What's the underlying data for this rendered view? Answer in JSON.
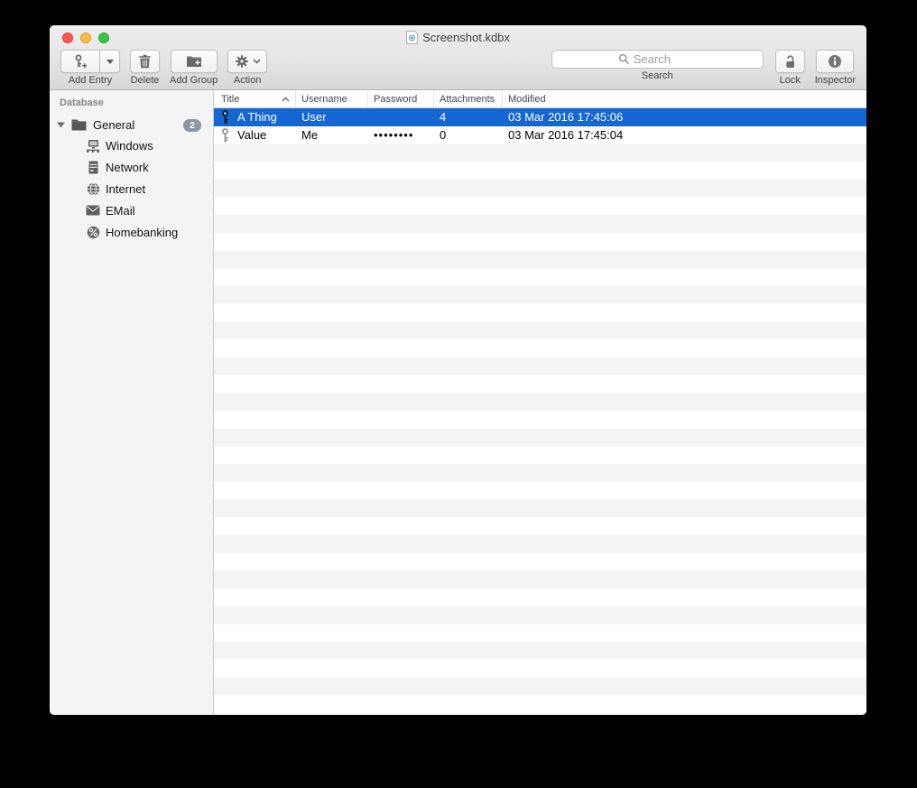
{
  "window": {
    "title": "Screenshot.kdbx",
    "proxy_icon": "kdbx-document-icon"
  },
  "toolbar": {
    "add_entry_label": "Add Entry",
    "delete_label": "Delete",
    "add_group_label": "Add Group",
    "action_label": "Action",
    "search_label": "Search",
    "search_placeholder": "Search",
    "search_value": "",
    "lock_label": "Lock",
    "inspector_label": "Inspector",
    "icons": [
      "key-plus-icon",
      "dropdown-arrow-icon",
      "trash-icon",
      "folder-plus-icon",
      "gear-icon",
      "chevron-down-icon",
      "magnifier-icon",
      "open-padlock-icon",
      "info-circle-icon"
    ]
  },
  "sidebar": {
    "header": "Database",
    "root": {
      "label": "General",
      "badge": "2",
      "icon": "folder-icon",
      "expanded": true
    },
    "items": [
      {
        "label": "Windows",
        "icon": "windows-network-icon"
      },
      {
        "label": "Network",
        "icon": "server-icon"
      },
      {
        "label": "Internet",
        "icon": "globe-icon"
      },
      {
        "label": "EMail",
        "icon": "envelope-icon"
      },
      {
        "label": "Homebanking",
        "icon": "percent-coin-icon"
      }
    ]
  },
  "table": {
    "columns": [
      {
        "label": "Title",
        "sorted": "ascending"
      },
      {
        "label": "Username"
      },
      {
        "label": "Password"
      },
      {
        "label": "Attachments"
      },
      {
        "label": "Modified"
      }
    ],
    "rows": [
      {
        "title": "A Thing",
        "username": "User",
        "password": "",
        "attachments": "4",
        "modified": "03 Mar 2016 17:45:06",
        "selected": true,
        "icon": "key-icon"
      },
      {
        "title": "Value",
        "username": "Me",
        "password": "••••••••",
        "attachments": "0",
        "modified": "03 Mar 2016 17:45:04",
        "selected": false,
        "icon": "key-icon"
      }
    ]
  },
  "colors": {
    "selection_blue": "#1467d2",
    "badge_gray": "#8d97a5",
    "stripe_gray": "#f4f4f5",
    "traffic_red": "#fc5753",
    "traffic_yellow": "#fdbc40",
    "traffic_green": "#33c748"
  }
}
